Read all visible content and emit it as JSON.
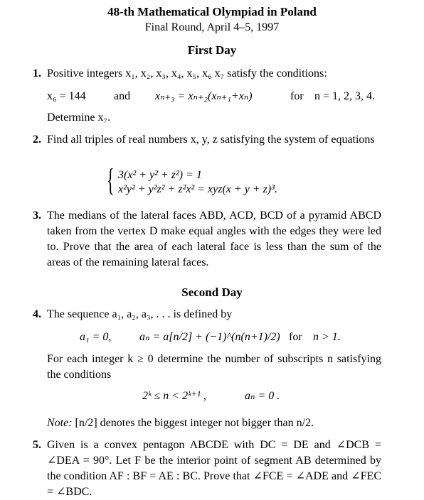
{
  "header": {
    "title": "48-th Mathematical Olympiad in Poland",
    "subtitle": "Final Round, April 4–5, 1997"
  },
  "days": [
    {
      "label": "First Day"
    },
    {
      "label": "Second Day"
    }
  ],
  "problems": [
    {
      "number": "1.",
      "intro": "Positive integers x₁, x₂, x₃, x₄, x₅, x₆ x₇ satisfy the conditions:",
      "condition_a": "x₆ = 144",
      "conj": "and",
      "condition_b": "xₙ₊₃ = xₙ₊₂(xₙ₊₁+xₙ)",
      "for": "for",
      "range": "n = 1, 2, 3, 4.",
      "ask": "Determine x₇."
    },
    {
      "number": "2.",
      "text": "Find all triples of real numbers x, y, z satisfying the system of equations",
      "eq1": "3(x² + y² + z²) = 1",
      "eq2": "x²y² + y²z² + z²x² = xyz(x + y + z)³."
    },
    {
      "number": "3.",
      "text": "The medians of the lateral faces ABD, ACD, BCD of a pyramid ABCD taken from the vertex D make equal angles with the edges they were led to. Prove that the area of each lateral face is less than the sum of the areas of the remaining lateral faces."
    },
    {
      "number": "4.",
      "intro": "The sequence a₁, a₂, a₃, . . . is defined by",
      "def_a": "a₁ = 0,",
      "def_b": "aₙ = a[n/2] + (−1)^(n(n+1)/2)",
      "for": "for",
      "range": "n > 1.",
      "text": "For each integer k ≥ 0 determine the number of subscripts n satisfying the conditions",
      "cond_a": "2ᵏ ≤ n < 2ᵏ⁺¹ ,",
      "cond_b": "aₙ = 0 .",
      "note_label": "Note:",
      "note": "[n/2] denotes the biggest integer not bigger than n/2."
    },
    {
      "number": "5.",
      "text": "Given is a convex pentagon ABCDE with DC = DE and ∠DCB = ∠DEA = 90°. Let F be the interior point of segment AB determined by the condition AF : BF = AE : BC. Prove that ∠FCE = ∠ADE and ∠FEC = ∠BDC."
    }
  ]
}
